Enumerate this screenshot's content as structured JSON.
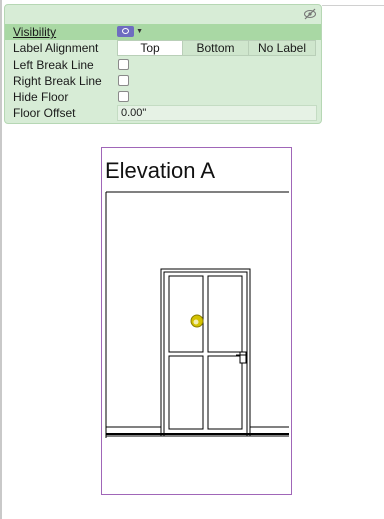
{
  "panel": {
    "hide_icon": "eye-slash-icon",
    "visibility": {
      "label": "Visibility",
      "icon": "eye-icon",
      "dropdown_icon": "caret-down-icon",
      "accent": "#6e6cc0"
    },
    "label_alignment": {
      "label": "Label Alignment",
      "options": [
        "Top",
        "Bottom",
        "No Label"
      ],
      "selected": "Top"
    },
    "left_break_line": {
      "label": "Left Break Line",
      "checked": false
    },
    "right_break_line": {
      "label": "Right Break Line",
      "checked": false
    },
    "hide_floor": {
      "label": "Hide Floor",
      "checked": false
    },
    "floor_offset": {
      "label": "Floor Offset",
      "value": "0.00\""
    }
  },
  "sheet": {
    "title": "Elevation A",
    "border_color": "#a066b8",
    "selection_marker_color": "#d4c200"
  }
}
